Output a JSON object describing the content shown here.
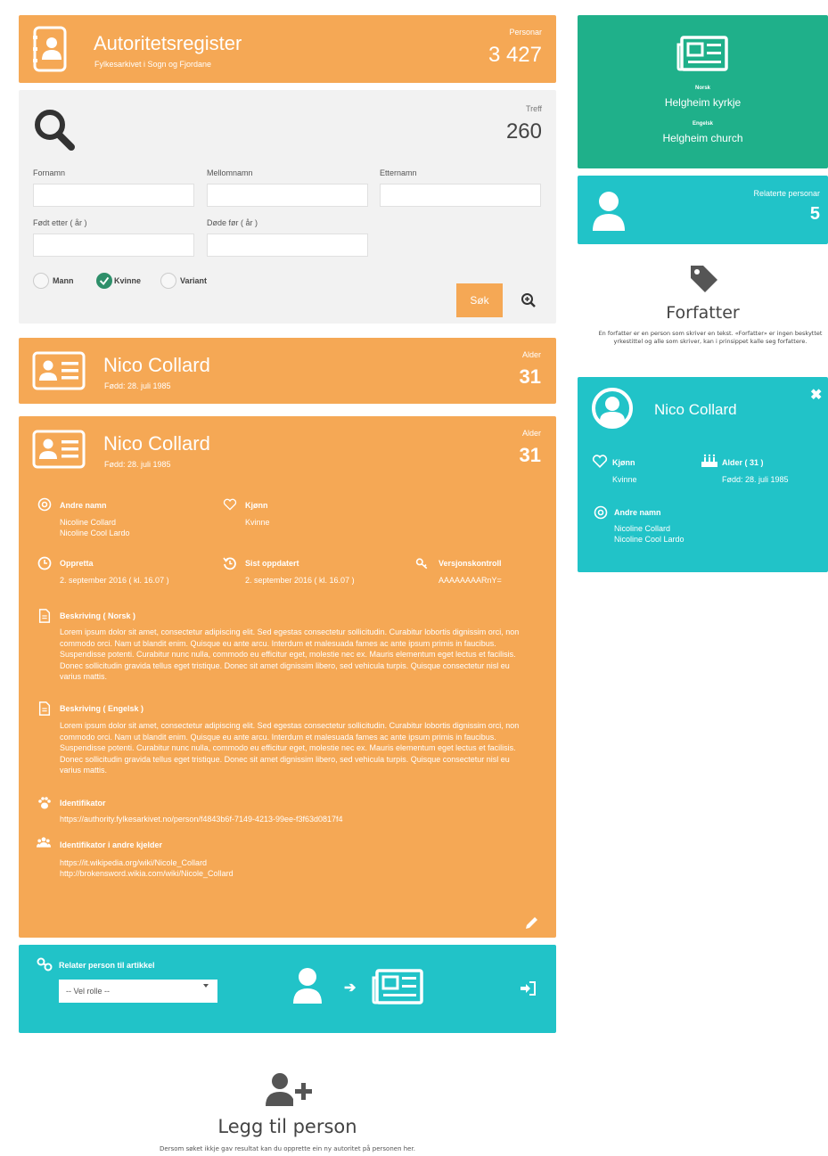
{
  "header": {
    "title": "Autoritetsregister",
    "subtitle": "Fylkesarkivet i Sogn og Fjordane",
    "count_label": "Personar",
    "count_value": "3 427"
  },
  "search": {
    "hits_label": "Treff",
    "hits_value": "260",
    "fields": {
      "fornamn": "Fornamn",
      "mellomnamn": "Mellomnamn",
      "etternamn": "Etternamn",
      "fodt_etter": "Født etter ( år )",
      "dode_for": "Døde før ( år )"
    },
    "gender": {
      "mann": "Mann",
      "kvinne": "Kvinne",
      "variant": "Variant",
      "selected": "kvinne"
    },
    "button": "Søk"
  },
  "person_summary": {
    "name": "Nico Collard",
    "born": "Fødd: 28. juli 1985",
    "age_label": "Alder",
    "age_value": "31"
  },
  "person_detail": {
    "name": "Nico Collard",
    "born": "Fødd: 28. juli 1985",
    "age_label": "Alder",
    "age_value": "31",
    "andre_namn_label": "Andre namn",
    "andre_namn": [
      "Nicoline Collard",
      "Nicoline Cool Lardo"
    ],
    "kjonn_label": "Kjønn",
    "kjonn_value": "Kvinne",
    "oppretta_label": "Oppretta",
    "oppretta_value": "2. september 2016 ( kl. 16.07 )",
    "oppdatert_label": "Sist oppdatert",
    "oppdatert_value": "2. september 2016 ( kl. 16.07 )",
    "versjon_label": "Versjonskontroll",
    "versjon_value": "AAAAAAAARnY=",
    "beskriving_norsk_label": "Beskriving ( Norsk )",
    "beskriving_norsk": "Lorem ipsum dolor sit amet, consectetur adipiscing elit. Sed egestas consectetur sollicitudin. Curabitur lobortis dignissim orci, non commodo orci. Nam ut blandit enim. Quisque eu ante arcu. Interdum et malesuada fames ac ante ipsum primis in faucibus. Suspendisse potenti. Curabitur nunc nulla, commodo eu efficitur eget, molestie nec ex. Mauris elementum eget lectus et facilisis. Donec sollicitudin gravida tellus eget tristique. Donec sit amet dignissim libero, sed vehicula turpis. Quisque consectetur nisl eu varius mattis.",
    "beskriving_engelsk_label": "Beskriving ( Engelsk )",
    "beskriving_engelsk": "Lorem ipsum dolor sit amet, consectetur adipiscing elit. Sed egestas consectetur sollicitudin. Curabitur lobortis dignissim orci, non commodo orci. Nam ut blandit enim. Quisque eu ante arcu. Interdum et malesuada fames ac ante ipsum primis in faucibus. Suspendisse potenti. Curabitur nunc nulla, commodo eu efficitur eget, molestie nec ex. Mauris elementum eget lectus et facilisis. Donec sollicitudin gravida tellus eget tristique. Donec sit amet dignissim libero, sed vehicula turpis. Quisque consectetur nisl eu varius mattis.",
    "identifikator_label": "Identifikator",
    "identifikator_value": "https://authority.fylkesarkivet.no/person/f4843b6f-7149-4213-99ee-f3f63d0817f4",
    "andre_kjelder_label": "Identifikator i andre kjelder",
    "andre_kjelder": [
      "https://it.wikipedia.org/wiki/Nicole_Collard",
      "http://brokensword.wikia.com/wiki/Nicole_Collard"
    ]
  },
  "relate": {
    "title": "Relater person til artikkel",
    "select_value": "-- Vel rolle --"
  },
  "add_person": {
    "title": "Legg til person",
    "text": "Dersom søket ikkje gav resultat kan du opprette ein ny autoritet på personen her."
  },
  "article": {
    "norsk_label": "Norsk",
    "norsk_title": "Helgheim kyrkje",
    "engelsk_label": "Engelsk",
    "engelsk_title": "Helgheim church"
  },
  "related_persons": {
    "label": "Relaterte personar",
    "value": "5"
  },
  "role": {
    "title": "Forfatter",
    "description": "En forfatter er en person som skriver en tekst. «Forfatter» er ingen beskyttet yrkestittel og alle som skriver, kan i prinsippet kalle seg forfattere."
  },
  "authority_card": {
    "name": "Nico Collard",
    "kjonn_label": "Kjønn",
    "kjonn_value": "Kvinne",
    "alder_label": "Alder ( 31 )",
    "alder_value": "Fødd: 28. juli 1985",
    "andre_namn_label": "Andre namn",
    "andre_namn": [
      "Nicoline Collard",
      "Nicoline Cool Lardo"
    ]
  },
  "colors": {
    "orange": "#f5a855",
    "teal": "#21c3c8",
    "green": "#1fb08a",
    "panel_grey": "#f2f2f2"
  }
}
